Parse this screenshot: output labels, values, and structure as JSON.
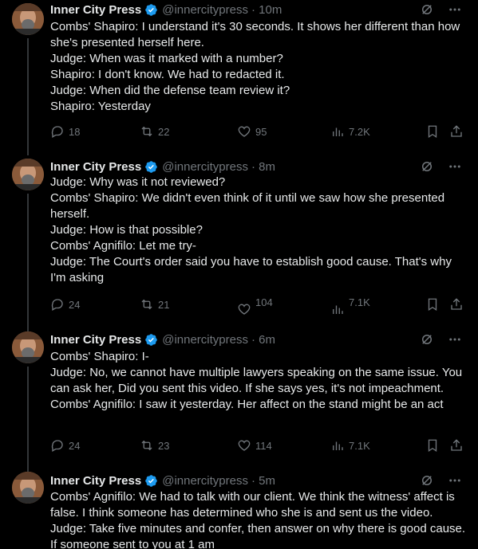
{
  "account": {
    "display_name": "Inner City Press",
    "handle": "@innercitypress"
  },
  "icons": {
    "verified": "verified-badge-icon",
    "grok": "grok-icon",
    "more": "more-icon",
    "reply": "reply-icon",
    "repost": "repost-icon",
    "like": "like-icon",
    "views": "views-icon",
    "bookmark": "bookmark-icon",
    "share": "share-icon"
  },
  "colors": {
    "background": "#000000",
    "text": "#e7e9ea",
    "muted": "#71767b",
    "verified": "#1d9bf0"
  },
  "tweets": [
    {
      "time": "· 10m",
      "lines": [
        "Combs' Shapiro: I understand it's 30 seconds. It shows her different than how she's presented herself here.",
        "Judge: When was it marked with a number?",
        "Shapiro: I don't know. We had to redacted it.",
        "Judge: When did the defense team review it?",
        "Shapiro: Yesterday"
      ],
      "replies": "18",
      "reposts": "22",
      "likes": "95",
      "views": "7.2K"
    },
    {
      "time": "· 8m",
      "lines": [
        "Judge: Why was it not reviewed?",
        "Combs' Shapiro: We didn't even think of it until we saw how she presented herself.",
        "Judge: How is that possible?",
        "Combs' Agnifilo: Let me try-",
        "Judge: The Court's order said you have to establish good cause. That's why I'm asking"
      ],
      "replies": "24",
      "reposts": "21",
      "likes": "104",
      "views": "7.1K"
    },
    {
      "time": "· 6m",
      "lines": [
        "Combs' Shapiro: I-",
        "Judge: No, we cannot have multiple lawyers speaking on the same issue. You can ask her, Did you sent this video. If she says yes, it's not impeachment.",
        "Combs' Agnifilo: I saw it yesterday. Her affect on the stand might be an act"
      ],
      "replies": "24",
      "reposts": "23",
      "likes": "114",
      "views": "7.1K"
    },
    {
      "time": "· 5m",
      "lines": [
        "Combs' Agnifilo: We had to talk with our client. We think the witness' affect is false. I think someone has determined who she is and sent us the video.",
        "Judge: Take five minutes and confer, then answer on why there is good cause. If someone sent to you at 1 am"
      ]
    }
  ]
}
